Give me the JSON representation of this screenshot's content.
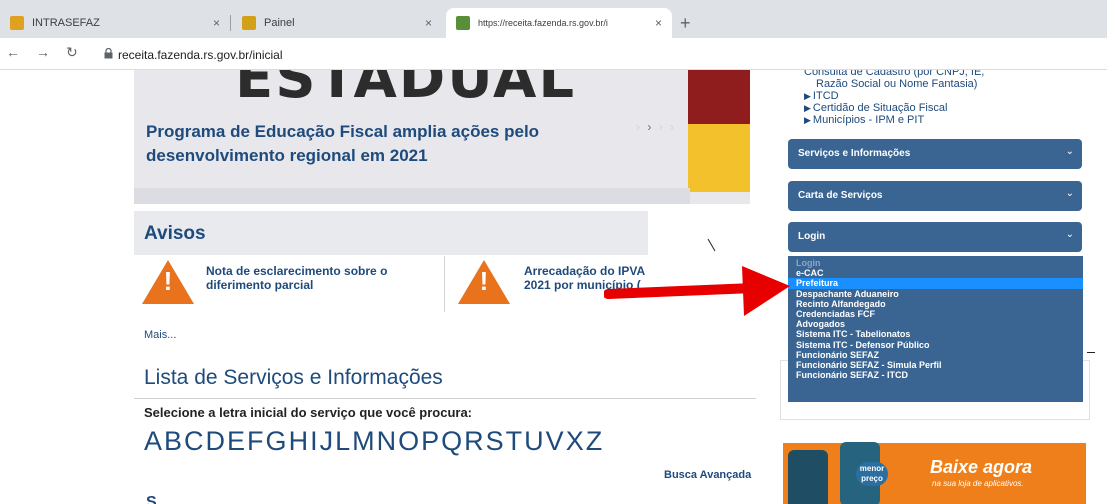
{
  "browser": {
    "tabs": [
      {
        "title": "INTRASEFAZ",
        "close": "×"
      },
      {
        "title": "Painel",
        "close": "×"
      },
      {
        "title": "https://receita.fazenda.rs.gov.br/i",
        "close": "×"
      }
    ],
    "new_tab": "+",
    "url": "receita.fazenda.rs.gov.br/inicial"
  },
  "banner": {
    "title": "ESTADUAL",
    "news_title": "Programa de Educação Fiscal amplia ações pelo desenvolvimento regional em 2021",
    "carousel_arrows": [
      "›",
      "›",
      "›",
      "›"
    ],
    "carousel_active_index": 1
  },
  "avisos": {
    "title": "Avisos",
    "items": [
      {
        "text": "Nota de esclarecimento sobre o diferimento parcial"
      },
      {
        "text": "Arrecadação do IPVA 2021 por município ("
      }
    ],
    "more": "Mais..."
  },
  "lista": {
    "title": "Lista de Serviços e Informações",
    "select_prompt": "Selecione a letra inicial do serviço que você procura:",
    "letters": [
      "A",
      "B",
      "C",
      "D",
      "E",
      "F",
      "G",
      "H",
      "I",
      "J",
      "L",
      "M",
      "N",
      "O",
      "P",
      "Q",
      "R",
      "S",
      "T",
      "U",
      "V",
      "X",
      "Z"
    ],
    "advanced_search": "Busca Avançada"
  },
  "sidebar": {
    "links": [
      "Consulta de Cadastro (por CNPJ, IE,",
      "Razão Social ou Nome Fantasia)",
      "ITCD",
      "Certidão de Situação Fiscal",
      "Municípios - IPM e PIT"
    ],
    "buttons": [
      {
        "label": "Serviços e Informações",
        "chevron": "⌄"
      },
      {
        "label": "Carta de Serviços",
        "chevron": "⌄"
      },
      {
        "label": "Login",
        "chevron": "⌄"
      }
    ]
  },
  "login_dropdown": {
    "options": [
      "Login",
      "e-CAC",
      "Prefeitura",
      "Despachante Aduaneiro",
      "Recinto Alfandegado",
      "Credenciadas FCF",
      "Advogados",
      "Sistema ITC - Tabelionatos",
      "Sistema ITC - Defensor Público",
      "Funcionário SEFAZ",
      "Funcionário SEFAZ - Simula Perfil",
      "Funcionário SEFAZ - ITCD"
    ],
    "selected_index": 2
  },
  "app_banner": {
    "menor_preco": "menor preço",
    "headline": "Baixe agora",
    "sub": "na sua loja de aplicativos."
  },
  "colors": {
    "brand_blue": "#1e4a7c",
    "sidebar_button": "#3a6593",
    "selected_option": "#1a8fff",
    "warning_orange": "#e8731c",
    "annotation_red": "#e60000"
  }
}
